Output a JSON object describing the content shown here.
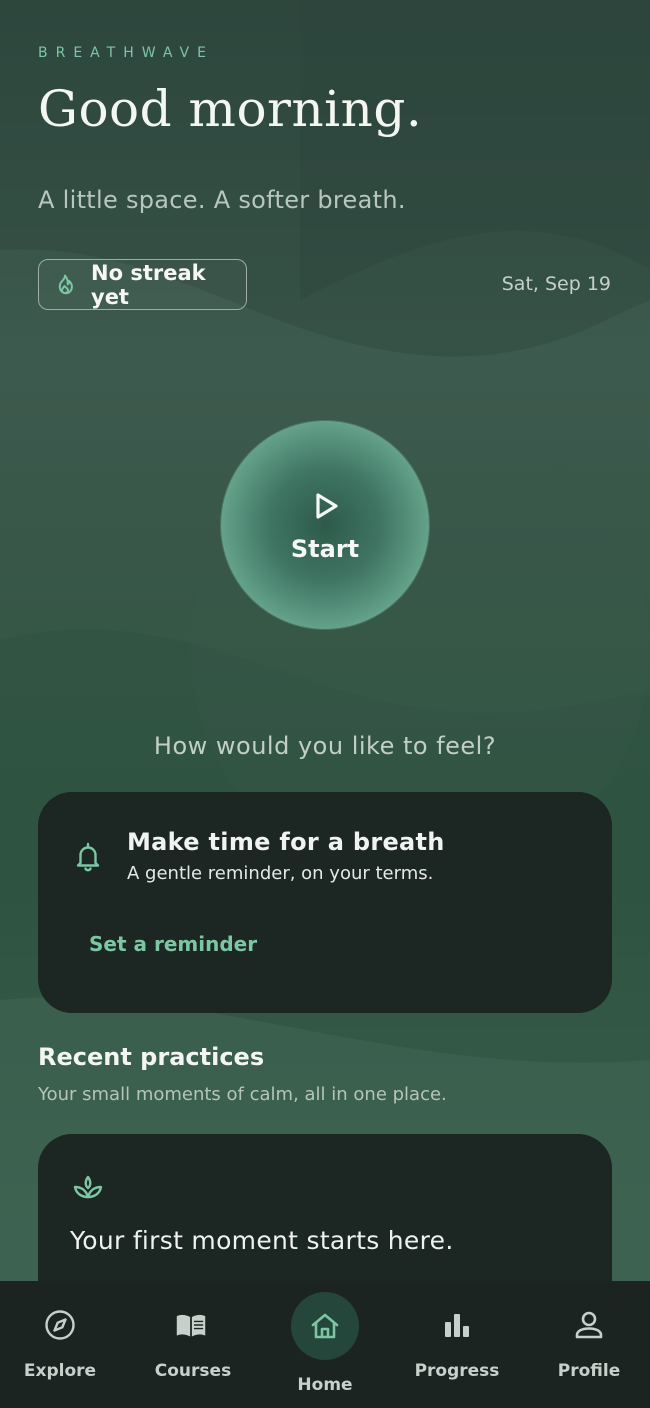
{
  "app": {
    "brand": "BREATHWAVE",
    "greeting": "Good morning.",
    "tagline": "A little space. A softer breath."
  },
  "status": {
    "streak_icon": "flame-icon",
    "streak_label": "No streak yet",
    "date": "Sat, Sep 19"
  },
  "start": {
    "icon": "play-icon",
    "label": "Start"
  },
  "prompt": "How would you like to feel?",
  "reminder_card": {
    "icon": "bell-icon",
    "title": "Make time for a breath",
    "subtitle": "A gentle reminder, on your terms.",
    "action": "Set a reminder"
  },
  "recent": {
    "title": "Recent practices",
    "subtitle": "Your small moments of calm, all in one place.",
    "empty_icon": "sprout-icon",
    "empty_text": "Your first moment starts here."
  },
  "nav": {
    "items": [
      {
        "label": "Explore",
        "icon": "compass-icon"
      },
      {
        "label": "Courses",
        "icon": "book-icon"
      },
      {
        "label": "Home",
        "icon": "home-icon",
        "active": true
      },
      {
        "label": "Progress",
        "icon": "bar-chart-icon"
      },
      {
        "label": "Profile",
        "icon": "person-icon"
      }
    ]
  },
  "colors": {
    "accent": "#7cc6a4",
    "card": "#1c2623",
    "nav_background": "#1b2421",
    "active_bubble": "#25463a"
  }
}
